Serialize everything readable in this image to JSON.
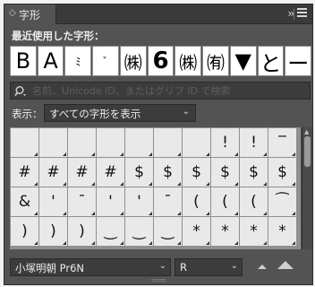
{
  "panel": {
    "tab_label": "字形",
    "tab_chevron": "◇",
    "collapse_glyph": "››"
  },
  "recent": {
    "label": "最近使用した字形：",
    "glyphs": [
      "B",
      "A",
      "ﾐ",
      "ﾞ",
      "㈱",
      "6",
      "㈱",
      "㈲",
      "▼",
      "と",
      "ー"
    ]
  },
  "search": {
    "placeholder": "名前、Unicode ID、またはグリフ ID で検索"
  },
  "show": {
    "label": "表示：",
    "value": "すべての字形を表示"
  },
  "grid": {
    "rows": [
      [
        "",
        "",
        "",
        "",
        "",
        "",
        "",
        "!",
        "!",
        "‾"
      ],
      [
        "#",
        "#",
        "#",
        "#",
        "$",
        "$",
        "$",
        "$",
        "$",
        "$"
      ],
      [
        "&",
        "'",
        "ˉ",
        "'",
        "'",
        "ˉ",
        "(",
        "(",
        "(",
        "⁀"
      ],
      [
        ")",
        ")",
        ")",
        "‿",
        "‿",
        "‿",
        "*",
        "*",
        "*",
        "*"
      ]
    ]
  },
  "font": {
    "family": "小塚明朝 Pr6N",
    "style": "R"
  }
}
